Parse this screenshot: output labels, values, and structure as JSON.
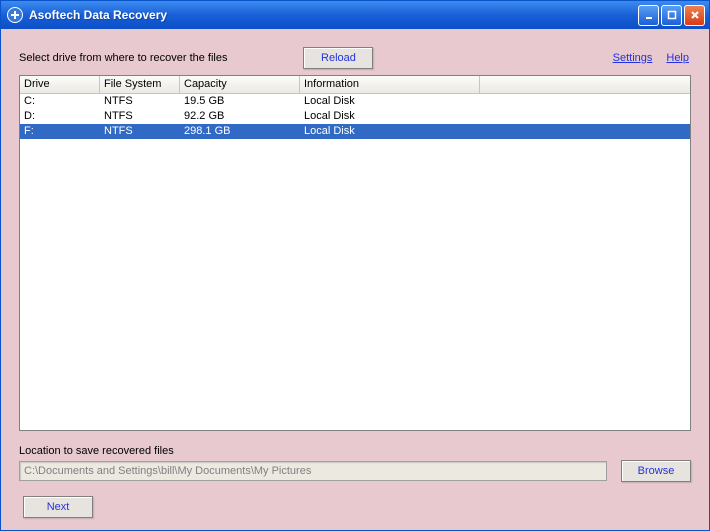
{
  "window": {
    "title": "Asoftech Data Recovery"
  },
  "prompt": "Select drive from where to recover the files",
  "reload_label": "Reload",
  "links": {
    "settings": "Settings",
    "help": "Help"
  },
  "columns": {
    "drive": "Drive",
    "fs": "File System",
    "cap": "Capacity",
    "info": "Information"
  },
  "drives": [
    {
      "drive": "C:",
      "fs": "NTFS",
      "cap": "19.5 GB",
      "info": "Local Disk",
      "selected": false
    },
    {
      "drive": "D:",
      "fs": "NTFS",
      "cap": "92.2 GB",
      "info": "Local Disk",
      "selected": false
    },
    {
      "drive": "F:",
      "fs": "NTFS",
      "cap": "298.1 GB",
      "info": "Local Disk",
      "selected": true
    }
  ],
  "location": {
    "label": "Location to save recovered files",
    "value": "C:\\Documents and Settings\\bill\\My Documents\\My Pictures",
    "browse_label": "Browse"
  },
  "next_label": "Next"
}
